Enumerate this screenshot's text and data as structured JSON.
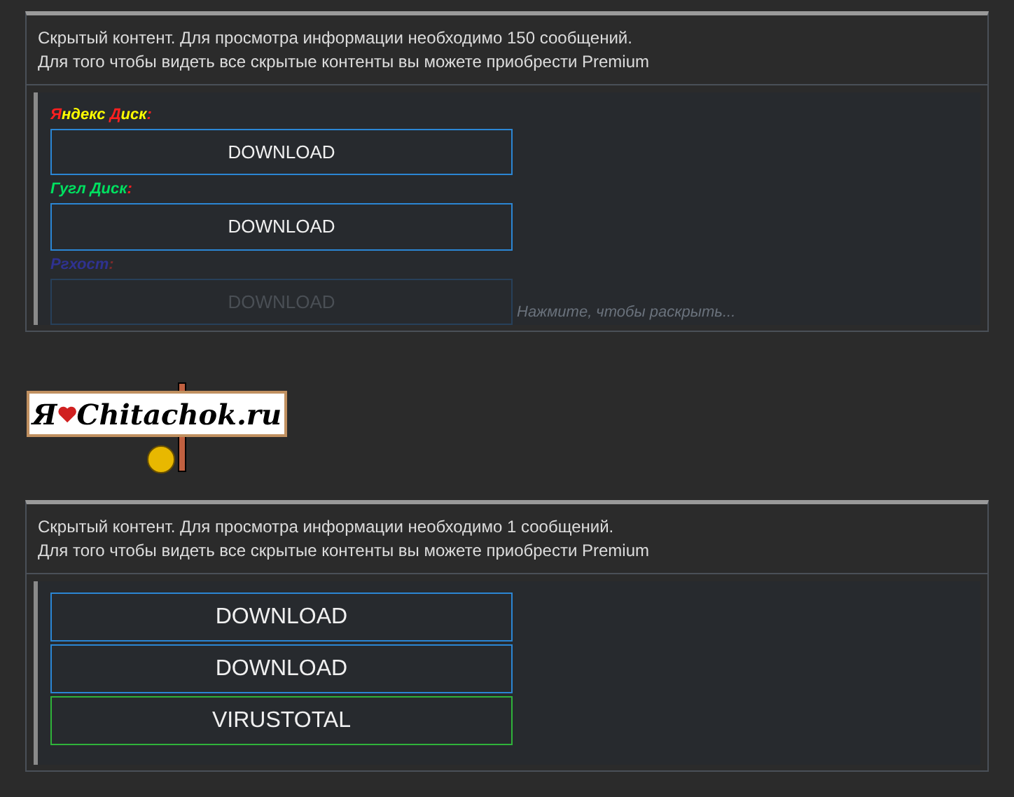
{
  "blocks": [
    {
      "notice": [
        "Скрытый контент. Для просмотра информации необходимо 150 сообщений.",
        "Для того чтобы видеть все скрытые контенты вы можете приобрести Premium"
      ],
      "collapsed": true,
      "expand_hint": "Нажмите, чтобы раскрыть...",
      "items": [
        {
          "kind": "label",
          "faded": false,
          "segments": [
            {
              "text": "Я",
              "color": "#ff2020"
            },
            {
              "text": "ндекс ",
              "color": "#ffff00"
            },
            {
              "text": "Д",
              "color": "#ff2020"
            },
            {
              "text": "иск",
              "color": "#ffff00"
            },
            {
              "text": ":",
              "color": "#ff2020"
            }
          ]
        },
        {
          "kind": "button",
          "label": "DOWNLOAD",
          "color": "#2b86d4",
          "faded": false
        },
        {
          "kind": "label",
          "faded": false,
          "segments": [
            {
              "text": "Гугл Диск",
              "color": "#00e060"
            },
            {
              "text": ":",
              "color": "#ff2020"
            }
          ]
        },
        {
          "kind": "button",
          "label": "DOWNLOAD",
          "color": "#2b86d4",
          "faded": false
        },
        {
          "kind": "label",
          "faded": false,
          "segments": [
            {
              "text": "Ргхост",
              "color": "#2f3290"
            },
            {
              "text": ":",
              "color": "#7a2a2a"
            }
          ]
        },
        {
          "kind": "button",
          "label": "DOWNLOAD",
          "color": "#27405a",
          "faded": true
        }
      ]
    },
    {
      "logo": {
        "left": "Я",
        "right": "Chitachok.ru"
      }
    },
    {
      "notice": [
        "Скрытый контент. Для просмотра информации необходимо 1 сообщений.",
        "Для того чтобы видеть все скрытые контенты вы можете приобрести Premium"
      ],
      "collapsed": false,
      "items": [
        {
          "kind": "button",
          "label": "DOWNLOAD",
          "color": "#2b86d4",
          "faded": false
        },
        {
          "kind": "button",
          "label": "DOWNLOAD",
          "color": "#2b86d4",
          "faded": false
        },
        {
          "kind": "button",
          "label": "VIRUSTOTAL",
          "color": "#2fb33a",
          "faded": false
        }
      ]
    }
  ]
}
